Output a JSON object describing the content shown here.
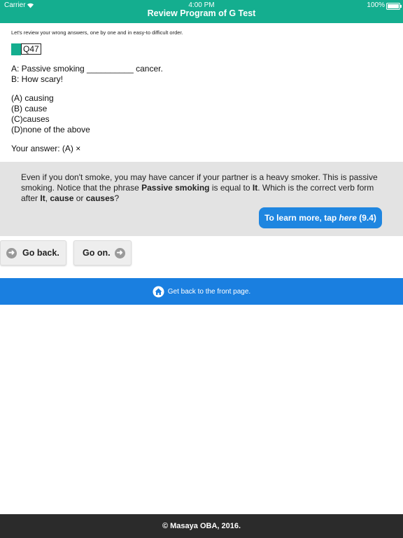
{
  "status_bar": {
    "carrier": "Carrier",
    "time": "4:00 PM",
    "battery": "100%"
  },
  "header": {
    "title": "Review Program of G Test"
  },
  "intro": "Let's review your wrong answers, one by one and in easy-to difficult order.",
  "question": {
    "number": "Q47",
    "line_a": "A: Passive smoking __________ cancer.",
    "line_b": "B: How scary!",
    "options": [
      "(A) causing",
      "(B) cause",
      "(C)causes",
      "(D)none of the above"
    ],
    "your_answer": "Your answer: (A) ×"
  },
  "explanation": {
    "part1": "Even if you don't smoke, you may have cancer if your partner is a heavy smoker. This is passive smoking. Notice that the phrase ",
    "bold1": "Passive smoking",
    "part2": " is equal to ",
    "bold2": "It",
    "part3": ". Which is the correct verb form after ",
    "bold3": "It",
    "part4": ", ",
    "bold4": "cause",
    "part5": " or ",
    "bold5": "causes",
    "part6": "?"
  },
  "learn_button": {
    "prefix": "To learn more, tap ",
    "link": "here",
    "suffix": " (9.4)"
  },
  "nav": {
    "back_label": "Go back.",
    "on_label": "Go on."
  },
  "front_page": {
    "label": "Get back to the front page."
  },
  "footer": {
    "copyright": "© Masaya OBA, 2016."
  },
  "colors": {
    "accent": "#14ae8f",
    "link_blue": "#1a7fe0",
    "footer_bg": "#2b2b2b"
  }
}
